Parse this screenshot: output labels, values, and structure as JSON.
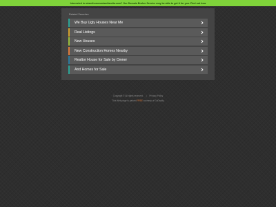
{
  "banner": {
    "text": "Interested in miamihomesmiamilandia.com? Our Domain Broker Service may be able to get it for you. Find out how",
    "color": "#7fd33a"
  },
  "panel": {
    "related_label": "Related Searches",
    "items": [
      {
        "label": "We Buy Ugly Houses Near Me",
        "stripe_color": "#2aa597",
        "icon": "chevron-right-icon"
      },
      {
        "label": "Real Listings",
        "stripe_color": "#d4a12a",
        "icon": "chevron-right-icon"
      },
      {
        "label": "New Houses",
        "stripe_color": "#9bbf3a",
        "icon": "chevron-right-icon"
      },
      {
        "label": "New Construction Homes Nearby",
        "stripe_color": "#e07a3a",
        "icon": "chevron-right-icon"
      },
      {
        "label": "Realtor House for Sale by Owner",
        "stripe_color": "#2a7a9f",
        "icon": "chevron-right-icon"
      },
      {
        "label": "And Homes for Sale",
        "stripe_color": "#2aa597",
        "icon": "chevron-right-icon"
      }
    ]
  },
  "footer": {
    "copyright": "Copyright ©",
    "rights": "All rights reserved.",
    "privacy": "Privacy Policy",
    "parked_prefix": "This Web page is parked",
    "parked_link": "FREE",
    "parked_suffix": "courtesy of GoDaddy"
  }
}
